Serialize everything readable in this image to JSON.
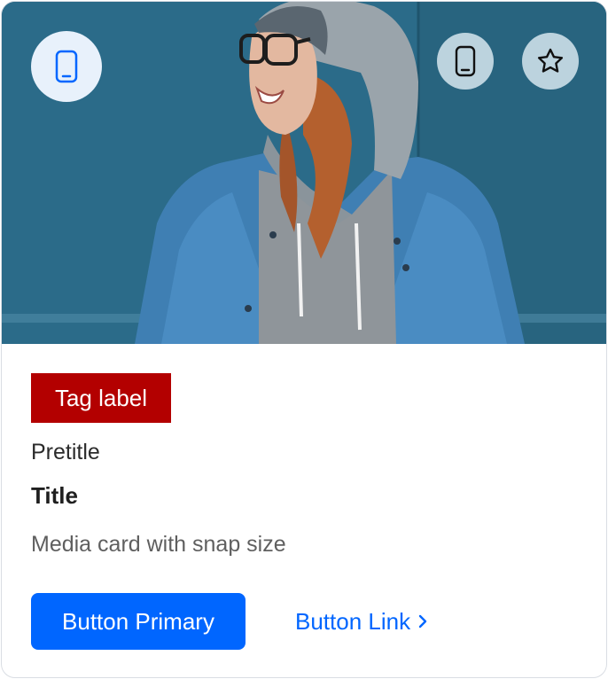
{
  "card": {
    "tag_label": "Tag label",
    "pretitle": "Pretitle",
    "title": "Title",
    "description": "Media card with snap size",
    "primary_button": "Button Primary",
    "link_button": "Button Link"
  },
  "media": {
    "left_icon": "mobile-icon",
    "right_icons": [
      "mobile-icon",
      "star-icon"
    ]
  },
  "colors": {
    "tag_bg": "#b30000",
    "primary": "#0066ff",
    "media_bg": "#2a6a88"
  }
}
